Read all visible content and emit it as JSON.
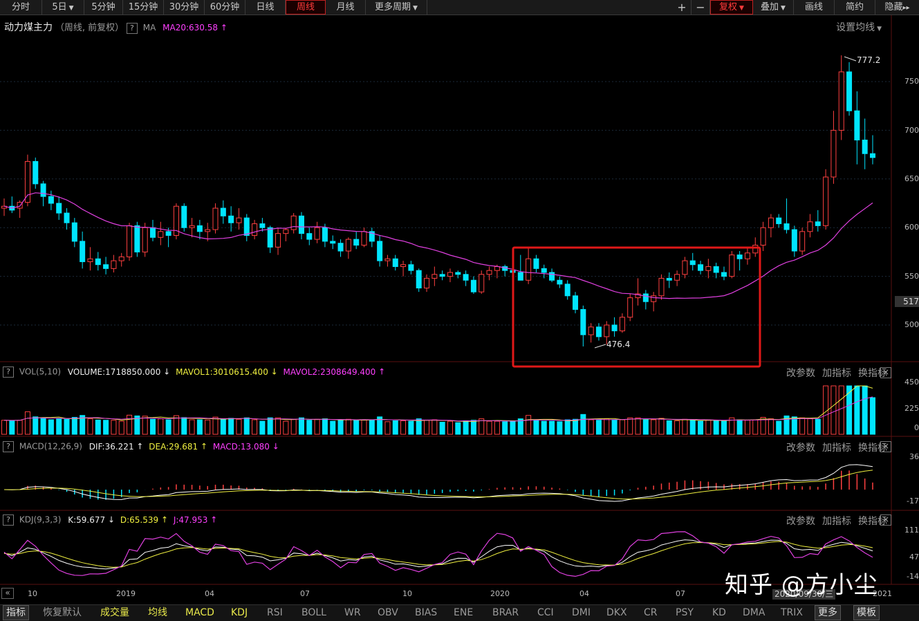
{
  "toolbar": {
    "periods": [
      "分时",
      "5日",
      "5分钟",
      "15分钟",
      "30分钟",
      "60分钟",
      "日线",
      "周线",
      "月线",
      "更多周期"
    ],
    "active_period": "周线",
    "plus": "+",
    "minus": "−",
    "restore": "复权",
    "overlay": "叠加",
    "draw": "画线",
    "simple": "简约",
    "hide": "隐藏",
    "hide_arrows": "▸▸"
  },
  "main_panel": {
    "stock_name": "动力煤主力",
    "mode": "（周线, 前复权）",
    "ma_label": "MA",
    "ma20": "MA20:630.58",
    "ma_arrow": "↑",
    "setting": "设置均线",
    "high_label": "777.2",
    "low_label": "476.4",
    "price_ticks": [
      "750",
      "700",
      "650",
      "600",
      "550",
      "500"
    ],
    "current_price": "517"
  },
  "vol_panel": {
    "name": "VOL(5,10)",
    "volume": "VOLUME:1718850.000",
    "volume_arrow": "↓",
    "mavol1": "MAVOL1:3010615.400",
    "mavol1_arrow": "↓",
    "mavol2": "MAVOL2:2308649.400",
    "mavol2_arrow": "↑",
    "ticks": [
      "450",
      "225",
      "0"
    ]
  },
  "macd_panel": {
    "name": "MACD(12,26,9)",
    "dif": "DIF:36.221",
    "dif_arrow": "↑",
    "dea": "DEA:29.681",
    "dea_arrow": "↑",
    "macd": "MACD:13.080",
    "macd_arrow": "↓",
    "ticks": [
      "36",
      "-17"
    ]
  },
  "kdj_panel": {
    "name": "KDJ(9,3,3)",
    "k": "K:59.677",
    "k_arrow": "↓",
    "d": "D:65.539",
    "d_arrow": "↑",
    "j": "J:47.953",
    "j_arrow": "↑",
    "ticks": [
      "111",
      "47",
      "-14"
    ]
  },
  "panel_links": {
    "params": "改参数",
    "add": "加指标",
    "switch": "换指标",
    "close": "×"
  },
  "x_axis": {
    "nav": "«",
    "labels": [
      "10",
      "2019",
      "04",
      "07",
      "10",
      "2020",
      "04",
      "07",
      "10",
      "2021"
    ],
    "cursor_date": "2020/09/30/三"
  },
  "bottom_bar": {
    "items": [
      "指标",
      "恢复默认",
      "成交量",
      "均线",
      "MACD",
      "KDJ",
      "RSI",
      "BOLL",
      "WR",
      "OBV",
      "BIAS",
      "ENE",
      "BRAR",
      "CCI",
      "DMI",
      "DKX",
      "CR",
      "PSY",
      "KD",
      "DMA",
      "TRIX",
      "更多",
      "模板"
    ]
  },
  "watermark": "知乎 @方小尘",
  "colors": {
    "up": "#ff4040",
    "down": "#00e5ff",
    "ma20": "#e040e0",
    "highlight_box": "#e01818",
    "dif": "#ffffff",
    "dea": "#f0f040",
    "j": "#e040e0"
  },
  "chart_data": {
    "type": "candlestick",
    "instrument": "动力煤主力",
    "period": "weekly",
    "ylim": [
      460,
      790
    ],
    "candles": [
      [
        620,
        630,
        612,
        622
      ],
      [
        622,
        632,
        615,
        618
      ],
      [
        620,
        628,
        610,
        626
      ],
      [
        626,
        675,
        622,
        668
      ],
      [
        668,
        672,
        640,
        645
      ],
      [
        645,
        648,
        622,
        632
      ],
      [
        632,
        638,
        618,
        625
      ],
      [
        625,
        632,
        608,
        615
      ],
      [
        615,
        620,
        598,
        605
      ],
      [
        605,
        610,
        580,
        586
      ],
      [
        586,
        596,
        558,
        565
      ],
      [
        565,
        580,
        556,
        568
      ],
      [
        568,
        575,
        556,
        562
      ],
      [
        562,
        570,
        552,
        558
      ],
      [
        558,
        572,
        554,
        566
      ],
      [
        566,
        574,
        560,
        570
      ],
      [
        570,
        605,
        566,
        602
      ],
      [
        602,
        606,
        570,
        575
      ],
      [
        575,
        605,
        570,
        600
      ],
      [
        600,
        608,
        586,
        590
      ],
      [
        590,
        606,
        582,
        596
      ],
      [
        596,
        600,
        580,
        592
      ],
      [
        592,
        625,
        588,
        622
      ],
      [
        622,
        625,
        596,
        600
      ],
      [
        600,
        610,
        590,
        602
      ],
      [
        602,
        608,
        588,
        596
      ],
      [
        596,
        605,
        586,
        598
      ],
      [
        598,
        625,
        594,
        620
      ],
      [
        620,
        628,
        604,
        612
      ],
      [
        612,
        622,
        596,
        605
      ],
      [
        605,
        620,
        598,
        610
      ],
      [
        610,
        614,
        586,
        592
      ],
      [
        592,
        608,
        588,
        604
      ],
      [
        604,
        610,
        596,
        600
      ],
      [
        600,
        602,
        574,
        580
      ],
      [
        580,
        600,
        572,
        594
      ],
      [
        594,
        600,
        586,
        598
      ],
      [
        598,
        615,
        594,
        612
      ],
      [
        612,
        616,
        588,
        594
      ],
      [
        594,
        600,
        582,
        588
      ],
      [
        588,
        606,
        584,
        600
      ],
      [
        600,
        604,
        580,
        586
      ],
      [
        586,
        592,
        578,
        584
      ],
      [
        584,
        588,
        570,
        576
      ],
      [
        576,
        590,
        568,
        588
      ],
      [
        588,
        596,
        578,
        582
      ],
      [
        582,
        600,
        580,
        596
      ],
      [
        596,
        600,
        580,
        586
      ],
      [
        586,
        592,
        560,
        566
      ],
      [
        566,
        572,
        560,
        568
      ],
      [
        568,
        572,
        556,
        560
      ],
      [
        560,
        566,
        550,
        562
      ],
      [
        562,
        566,
        552,
        556
      ],
      [
        556,
        558,
        534,
        538
      ],
      [
        538,
        552,
        534,
        548
      ],
      [
        548,
        560,
        540,
        552
      ],
      [
        552,
        556,
        546,
        550
      ],
      [
        550,
        558,
        544,
        554
      ],
      [
        554,
        556,
        548,
        552
      ],
      [
        552,
        556,
        540,
        546
      ],
      [
        546,
        550,
        532,
        534
      ],
      [
        534,
        556,
        532,
        552
      ],
      [
        552,
        560,
        546,
        556
      ],
      [
        556,
        562,
        548,
        560
      ],
      [
        560,
        562,
        550,
        556
      ],
      [
        556,
        562,
        548,
        554
      ],
      [
        554,
        572,
        548,
        546
      ],
      [
        546,
        580,
        542,
        568
      ],
      [
        568,
        572,
        554,
        558
      ],
      [
        558,
        562,
        548,
        554
      ],
      [
        554,
        558,
        544,
        546
      ],
      [
        546,
        550,
        538,
        542
      ],
      [
        542,
        546,
        526,
        530
      ],
      [
        530,
        534,
        512,
        516
      ],
      [
        516,
        520,
        478,
        490
      ],
      [
        490,
        502,
        482,
        498
      ],
      [
        498,
        502,
        484,
        488
      ],
      [
        488,
        504,
        480,
        500
      ],
      [
        500,
        508,
        488,
        494
      ],
      [
        494,
        512,
        492,
        508
      ],
      [
        508,
        532,
        504,
        528
      ],
      [
        528,
        548,
        520,
        532
      ],
      [
        532,
        536,
        516,
        524
      ],
      [
        524,
        534,
        514,
        530
      ],
      [
        530,
        552,
        526,
        548
      ],
      [
        548,
        554,
        538,
        546
      ],
      [
        546,
        556,
        540,
        552
      ],
      [
        552,
        570,
        548,
        566
      ],
      [
        566,
        574,
        556,
        562
      ],
      [
        562,
        566,
        552,
        556
      ],
      [
        556,
        568,
        548,
        560
      ],
      [
        560,
        564,
        548,
        554
      ],
      [
        554,
        560,
        546,
        550
      ],
      [
        550,
        576,
        548,
        572
      ],
      [
        572,
        576,
        556,
        568
      ],
      [
        568,
        580,
        562,
        574
      ],
      [
        574,
        590,
        570,
        582
      ],
      [
        582,
        606,
        576,
        600
      ],
      [
        600,
        614,
        590,
        610
      ],
      [
        610,
        614,
        600,
        604
      ],
      [
        604,
        630,
        594,
        598
      ],
      [
        598,
        602,
        570,
        576
      ],
      [
        576,
        600,
        572,
        596
      ],
      [
        596,
        614,
        590,
        606
      ],
      [
        606,
        618,
        596,
        602
      ],
      [
        602,
        660,
        598,
        652
      ],
      [
        652,
        720,
        645,
        700
      ],
      [
        700,
        777,
        690,
        760
      ],
      [
        760,
        770,
        715,
        720
      ],
      [
        720,
        740,
        665,
        690
      ],
      [
        690,
        712,
        660,
        676
      ],
      [
        676,
        695,
        665,
        672
      ]
    ],
    "ma20": [],
    "annotations": [
      {
        "text": "777.2",
        "type": "high"
      },
      {
        "text": "476.4",
        "type": "low"
      }
    ]
  }
}
